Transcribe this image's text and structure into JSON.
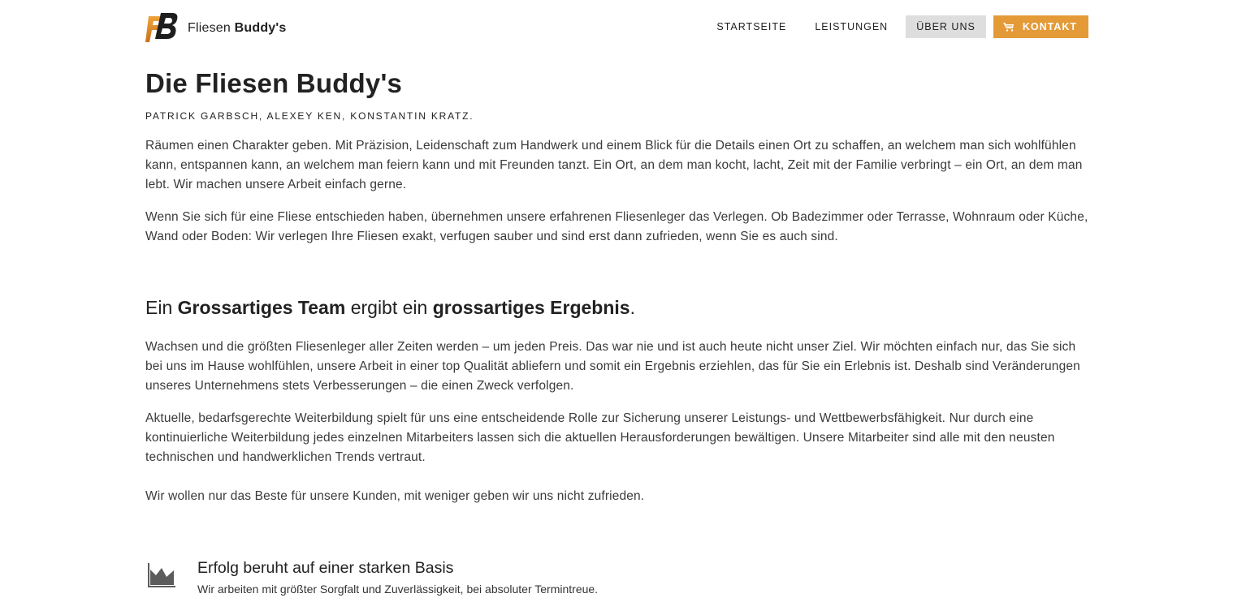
{
  "header": {
    "brand_light": "Fliesen ",
    "brand_bold": "Buddy's",
    "logo_letters": "FB",
    "nav": [
      {
        "label": "STARTSEITE"
      },
      {
        "label": "LEISTUNGEN"
      },
      {
        "label": "ÜBER UNS"
      },
      {
        "label": "KONTAKT"
      }
    ],
    "colors": {
      "accent": "#e39a37",
      "active_bg": "#dedede",
      "text": "#222222"
    }
  },
  "main": {
    "title": "Die Fliesen Buddy's",
    "subtitle": "PATRICK GARBSCH, ALEXEY KEN, KONSTANTIN KRATZ.",
    "paragraph1": "Räumen einen Charakter geben. Mit Präzision, Leidenschaft zum Handwerk und einem Blick für die Details einen Ort zu schaffen, an welchem man sich wohlfühlen kann, entspannen kann, an welchem man feiern kann und mit Freunden tanzt. Ein Ort, an dem man kocht, lacht, Zeit mit der Familie verbringt – ein Ort, an dem man lebt. Wir machen unsere Arbeit einfach gerne.",
    "paragraph2": "Wenn Sie sich für eine Fliese entschieden haben, übernehmen unsere erfahrenen Fliesenleger das Verlegen. Ob Badezimmer oder Terrasse, Wohnraum oder Küche, Wand oder Boden: Wir verlegen Ihre Fliesen exakt, verfugen sauber und sind erst dann zufrieden, wenn Sie es auch sind.",
    "team_heading": {
      "part1": "Ein ",
      "bold1": "Grossartiges Team",
      "part2": " ergibt ein ",
      "bold2": "grossartiges Ergebnis",
      "part3": "."
    },
    "paragraph3": "Wachsen und die größten Fliesenleger aller Zeiten werden – um jeden Preis. Das war nie und ist auch heute nicht unser Ziel. Wir möchten einfach nur, das Sie sich bei uns im Hause wohlfühlen, unsere Arbeit in einer top Qualität abliefern und somit ein Ergebnis erziehlen, das für Sie ein Erlebnis ist. Deshalb sind Veränderungen unseres Unternehmens stets Verbesserungen – die einen Zweck verfolgen.",
    "paragraph4": "Aktuelle, bedarfsgerechte Weiterbildung spielt für uns eine entscheidende Rolle zur Sicherung unserer Leistungs- und Wettbewerbsfähigkeit. Nur durch eine kontinuierliche Weiterbildung jedes einzelnen Mitarbeiters lassen sich die aktuellen Herausforderungen bewältigen. Unsere Mitarbeiter sind alle mit den neusten technischen und handwerklichen Trends vertraut.",
    "paragraph5": "Wir wollen nur das Beste für unsere Kunden, mit weniger geben wir uns nicht zufrieden."
  },
  "feature": {
    "icon": "area-chart-icon",
    "title": "Erfolg beruht auf einer starken Basis",
    "text": "Wir arbeiten mit größter Sorgfalt und Zuverlässigkeit, bei absoluter Termintreue."
  }
}
